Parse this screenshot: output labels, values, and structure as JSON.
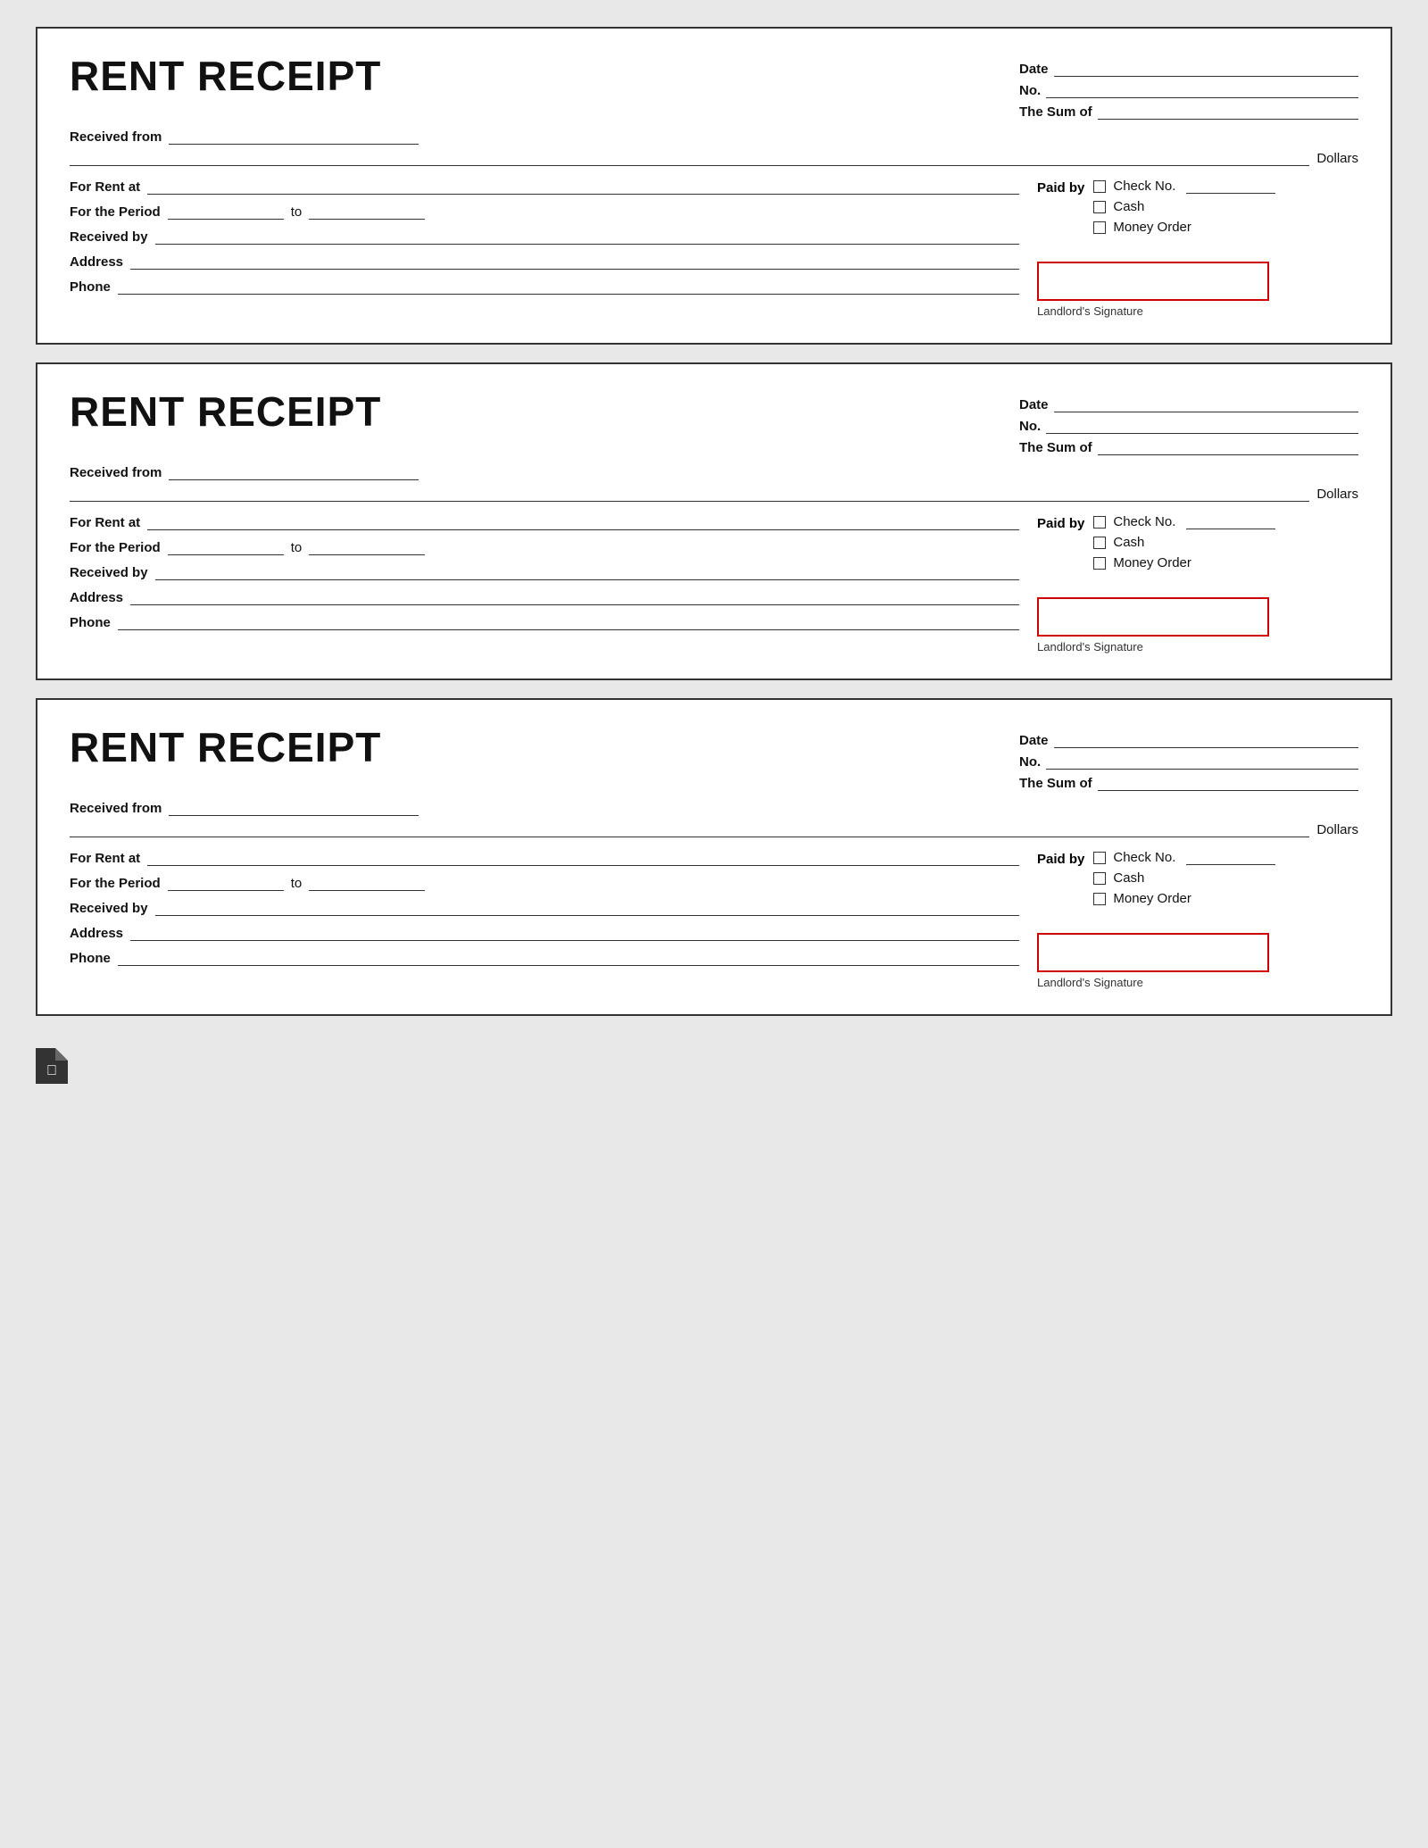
{
  "receipts": [
    {
      "id": 1,
      "title": "RENT RECEIPT",
      "date_label": "Date",
      "no_label": "No.",
      "sum_label": "The Sum of",
      "dollars_label": "Dollars",
      "received_from_label": "Received from",
      "for_rent_label": "For Rent at",
      "period_label": "For the Period",
      "to_label": "to",
      "received_by_label": "Received by",
      "address_label": "Address",
      "phone_label": "Phone",
      "paid_by_label": "Paid by",
      "check_no_label": "Check No.",
      "cash_label": "Cash",
      "money_order_label": "Money Order",
      "signature_label": "Landlord's Signature"
    },
    {
      "id": 2,
      "title": "RENT RECEIPT",
      "date_label": "Date",
      "no_label": "No.",
      "sum_label": "The Sum of",
      "dollars_label": "Dollars",
      "received_from_label": "Received from",
      "for_rent_label": "For Rent at",
      "period_label": "For the Period",
      "to_label": "to",
      "received_by_label": "Received by",
      "address_label": "Address",
      "phone_label": "Phone",
      "paid_by_label": "Paid by",
      "check_no_label": "Check No.",
      "cash_label": "Cash",
      "money_order_label": "Money Order",
      "signature_label": "Landlord's Signature"
    },
    {
      "id": 3,
      "title": "RENT RECEIPT",
      "date_label": "Date",
      "no_label": "No.",
      "sum_label": "The Sum of",
      "dollars_label": "Dollars",
      "received_from_label": "Received from",
      "for_rent_label": "For Rent at",
      "period_label": "For the Period",
      "to_label": "to",
      "received_by_label": "Received by",
      "address_label": "Address",
      "phone_label": "Phone",
      "paid_by_label": "Paid by",
      "check_no_label": "Check No.",
      "cash_label": "Cash",
      "money_order_label": "Money Order",
      "signature_label": "Landlord's Signature"
    }
  ],
  "footer": {
    "icon_name": "document-icon"
  }
}
